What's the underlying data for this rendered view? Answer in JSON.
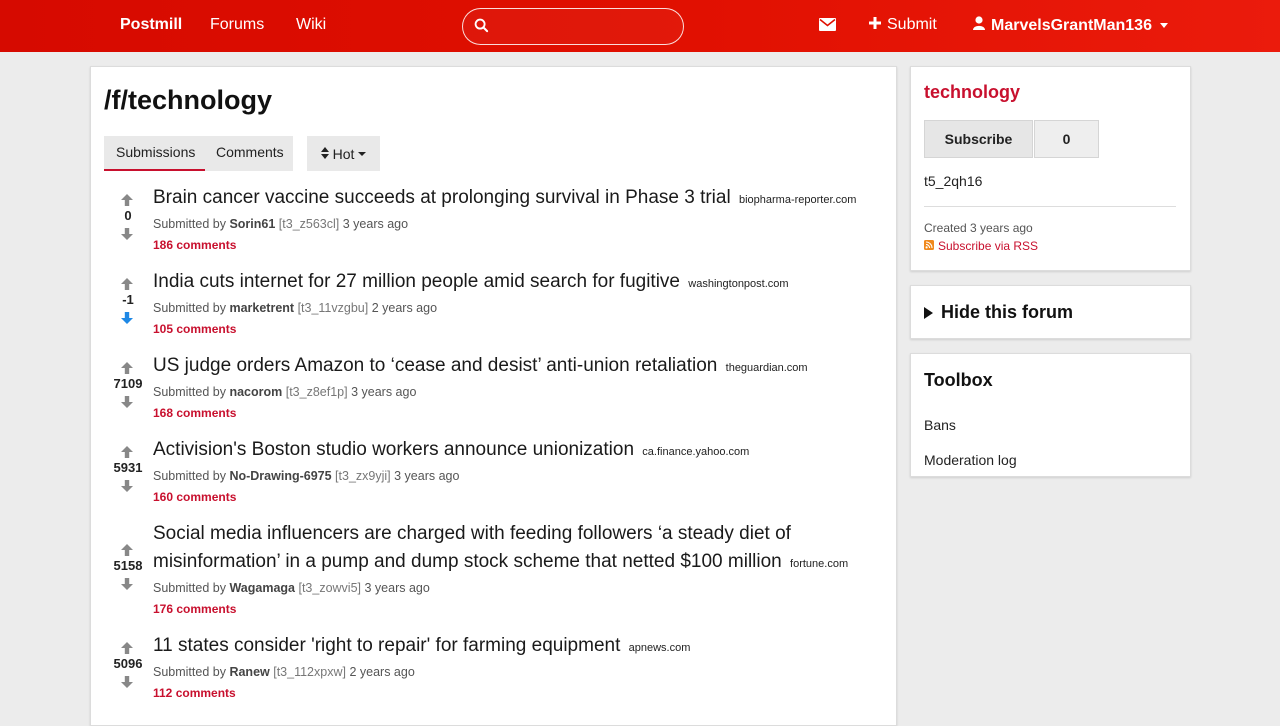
{
  "nav": {
    "brand": "Postmill",
    "links": [
      "Forums",
      "Wiki"
    ],
    "search_placeholder": "",
    "submit_label": "Submit",
    "username": "MarvelsGrantMan136"
  },
  "forum": {
    "title": "/f/technology",
    "tabs": [
      {
        "label": "Submissions",
        "active": true
      },
      {
        "label": "Comments",
        "active": false
      }
    ],
    "sort_label": "Hot"
  },
  "posts": [
    {
      "score": "0",
      "title": "Brain cancer vaccine succeeds at prolonging survival in Phase 3 trial",
      "domain": "biopharma-reporter.com",
      "submitted_by": "Submitted by",
      "author": "Sorin61",
      "tid": "[t3_z563cl]",
      "time": "3 years ago",
      "comments": "186 comments",
      "downvoted": false
    },
    {
      "score": "-1",
      "title": "India cuts internet for 27 million people amid search for fugitive",
      "domain": "washingtonpost.com",
      "submitted_by": "Submitted by",
      "author": "marketrent",
      "tid": "[t3_11vzgbu]",
      "time": "2 years ago",
      "comments": "105 comments",
      "downvoted": true
    },
    {
      "score": "7109",
      "title": "US judge orders Amazon to ‘cease and desist’ anti-union retaliation",
      "domain": "theguardian.com",
      "submitted_by": "Submitted by",
      "author": "nacorom",
      "tid": "[t3_z8ef1p]",
      "time": "3 years ago",
      "comments": "168 comments",
      "downvoted": false
    },
    {
      "score": "5931",
      "title": "Activision's Boston studio workers announce unionization",
      "domain": "ca.finance.yahoo.com",
      "submitted_by": "Submitted by",
      "author": "No-Drawing-6975",
      "tid": "[t3_zx9yji]",
      "time": "3 years ago",
      "comments": "160 comments",
      "downvoted": false
    },
    {
      "score": "5158",
      "title": "Social media influencers are charged with feeding followers ‘a steady diet of misinformation’ in a pump and dump stock scheme that netted $100 million",
      "domain": "fortune.com",
      "submitted_by": "Submitted by",
      "author": "Wagamaga",
      "tid": "[t3_zowvi5]",
      "time": "3 years ago",
      "comments": "176 comments",
      "downvoted": false
    },
    {
      "score": "5096",
      "title": "11 states consider 'right to repair' for farming equipment",
      "domain": "apnews.com",
      "submitted_by": "Submitted by",
      "author": "Ranew",
      "tid": "[t3_112xpxw]",
      "time": "2 years ago",
      "comments": "112 comments",
      "downvoted": false
    }
  ],
  "sidebar": {
    "forum_name": "technology",
    "subscribe_label": "Subscribe",
    "subscriber_count": "0",
    "forum_id": "t5_2qh16",
    "created": "Created 3 years ago",
    "rss_label": "Subscribe via RSS",
    "hide_label": "Hide this forum",
    "toolbox_title": "Toolbox",
    "toolbox_links": [
      "Bans",
      "Moderation log"
    ]
  },
  "colors": {
    "nav_bg": "#e00f00",
    "accent": "#c8102e",
    "downvote": "#1e88e5"
  }
}
